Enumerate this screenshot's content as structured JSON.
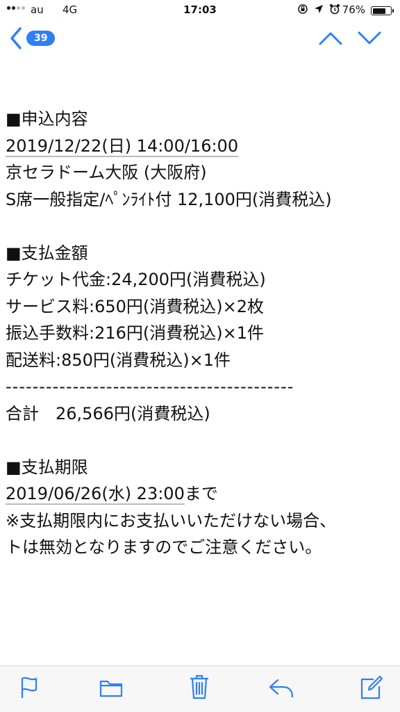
{
  "status_bar": {
    "carrier": "au",
    "network": "4G",
    "time": "17:03",
    "battery_percent": "76%",
    "battery_level": 0.76,
    "signal_bars_on": 2,
    "signal_bars_total": 4
  },
  "nav": {
    "back_count": "39"
  },
  "email": {
    "lines": [
      {
        "text": "■申込内容",
        "underline": false
      },
      {
        "text": "2019/12/22(日) 14:00/16:00",
        "underline": true
      },
      {
        "text": "京セラドーム大阪 (大阪府)",
        "underline": false
      },
      {
        "text": "S席一般指定/ﾍﾟﾝﾗｲﾄ付 12,100円(消費税込)",
        "underline": false
      },
      {
        "text": "",
        "underline": false
      },
      {
        "text": "■支払金額",
        "underline": false
      },
      {
        "text": "チケット代金:24,200円(消費税込)",
        "underline": false
      },
      {
        "text": "サービス料:650円(消費税込)×2枚",
        "underline": false
      },
      {
        "text": "振込手数料:216円(消費税込)×1件",
        "underline": false
      },
      {
        "text": "配送料:850円(消費税込)×1件",
        "underline": false
      },
      {
        "text": "-------------------------------------------",
        "underline": false,
        "dash": true
      },
      {
        "text": "合計　26,566円(消費税込)",
        "underline": false
      },
      {
        "text": "",
        "underline": false
      },
      {
        "text": "■支払期限",
        "underline": false
      },
      {
        "text": "2019/06/26(水) 23:00",
        "underline": true,
        "suffix": "まで"
      },
      {
        "text": "※支払期限内にお支払いいただけない場合、",
        "underline": false
      },
      {
        "text": "トは無効となりますのでご注意ください。",
        "underline": false
      }
    ]
  },
  "colors": {
    "accent": "#2f7ff5",
    "toolbar_bg": "#f7f7f7"
  },
  "toolbar": {
    "icons": [
      "flag-icon",
      "folder-icon",
      "trash-icon",
      "reply-icon",
      "compose-icon"
    ]
  }
}
